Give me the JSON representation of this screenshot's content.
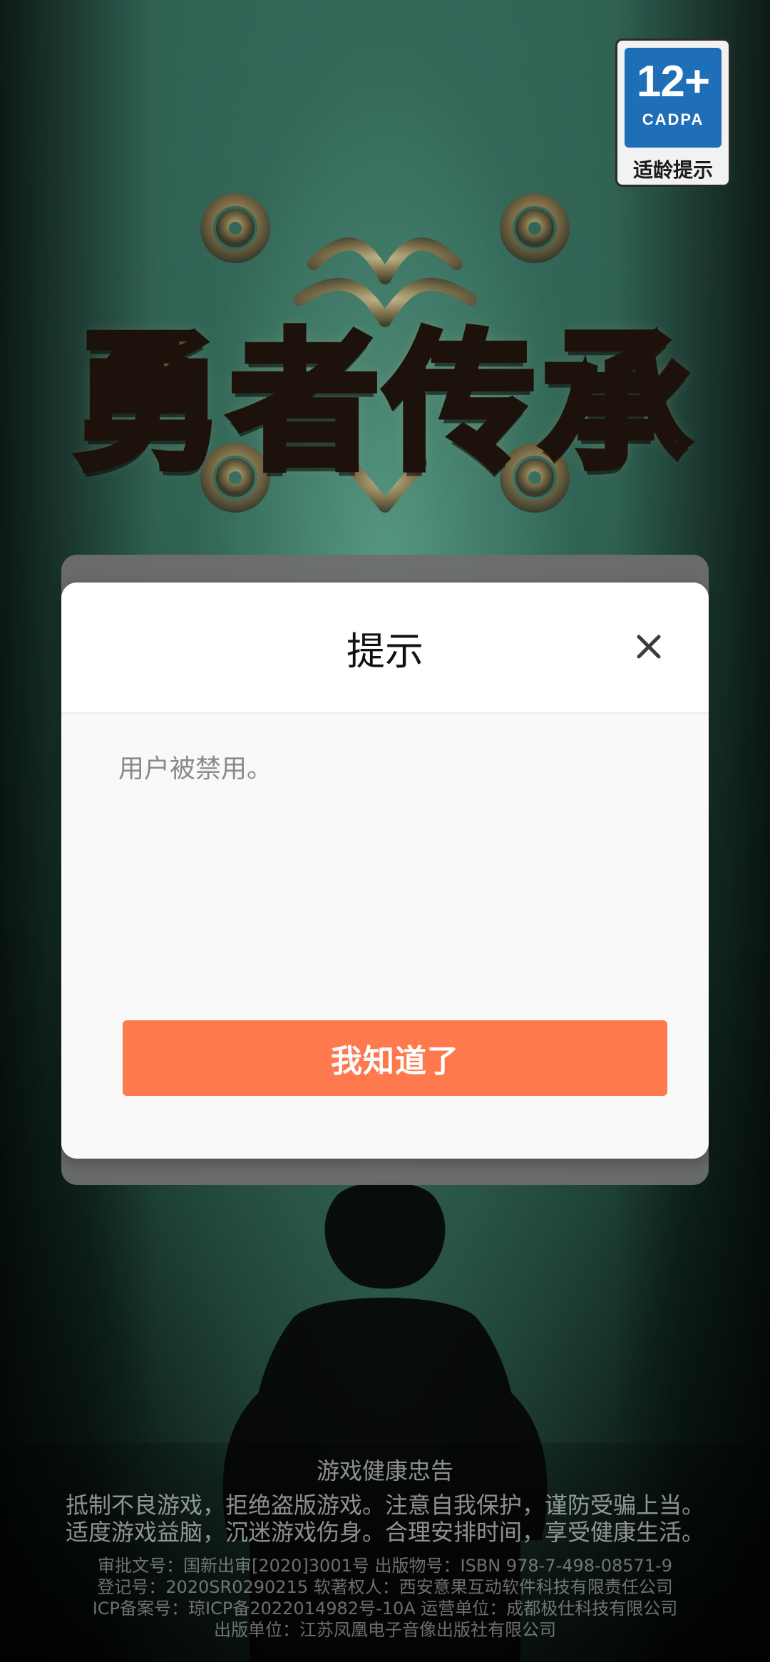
{
  "game": {
    "title": "勇者传承"
  },
  "age_badge": {
    "rating": "12+",
    "org": "CADPA",
    "note": "适龄提示",
    "colors": {
      "primary": "#1f6fb8",
      "frame": "#2b2b2b"
    }
  },
  "modal": {
    "title": "提示",
    "message": "用户被禁用。",
    "confirm_label": "我知道了",
    "icons": {
      "close": "close-icon"
    },
    "colors": {
      "confirm_bg": "#fe7a4e",
      "message_text": "#8a8a8a"
    }
  },
  "footer": {
    "health_title": "游戏健康忠告",
    "health_lines": [
      "抵制不良游戏，拒绝盗版游戏。注意自我保护，谨防受骗上当。",
      "适度游戏益脑，沉迷游戏伤身。合理安排时间，享受健康生活。"
    ],
    "registration_lines": [
      "审批文号：国新出审[2020]3001号  出版物号：ISBN 978-7-498-08571-9",
      "登记号：2020SR0290215  软著权人：西安意果互动软件科技有限责任公司",
      "ICP备案号：琼ICP备2022014982号-10A 运营单位：成都极仕科技有限公司",
      "出版单位：江苏凤凰电子音像出版社有限公司"
    ]
  }
}
